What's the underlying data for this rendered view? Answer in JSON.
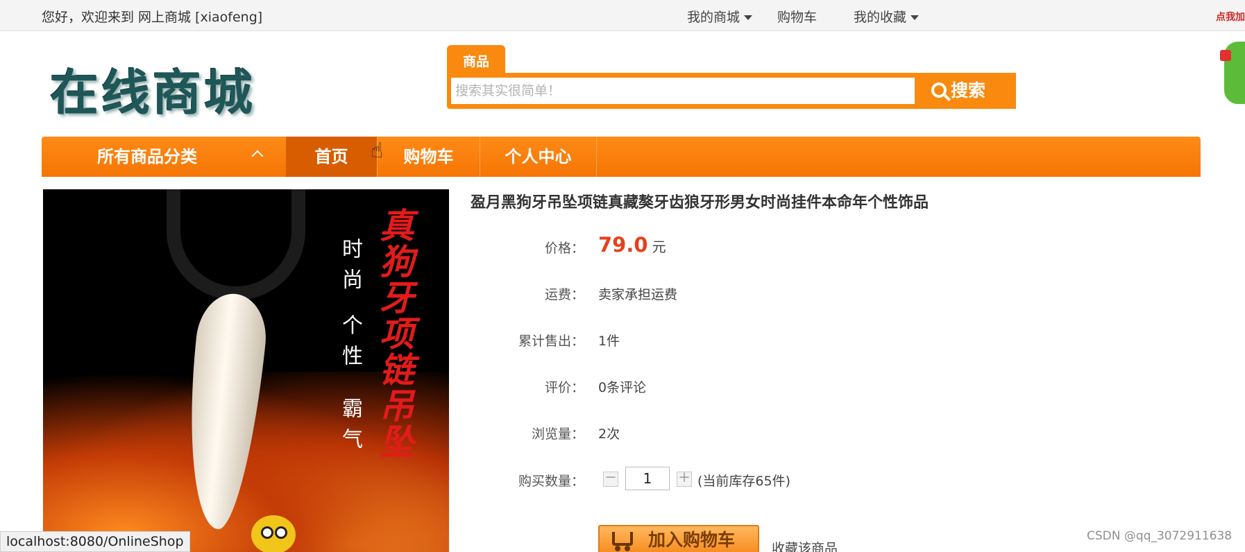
{
  "topbar": {
    "welcome": "您好，欢迎来到 网上商城 [xiaofeng]",
    "my_shop": "我的商城",
    "cart": "购物车",
    "favorites": "我的收藏",
    "ad_text": "点我加"
  },
  "logo": {
    "text": "在线商城"
  },
  "search": {
    "tab_label": "商品",
    "placeholder": "搜索其实很简单！",
    "button_label": "搜索"
  },
  "nav": {
    "category_label": "所有商品分类",
    "items": [
      {
        "label": "首页",
        "active": true
      },
      {
        "label": "购物车",
        "active": false
      },
      {
        "label": "个人中心",
        "active": false
      }
    ]
  },
  "product_image": {
    "text_white_1": "时尚",
    "text_white_2": "个性",
    "text_white_3": "霸气",
    "text_red": "真狗牙项链吊坠"
  },
  "product": {
    "title": "盈月黑狗牙吊坠项链真藏獒牙齿狼牙形男女时尚挂件本命年个性饰品",
    "price_label": "价格：",
    "price": "79.0",
    "price_unit": "元",
    "shipping_label": "运费：",
    "shipping": "卖家承担运费",
    "sold_label": "累计售出：",
    "sold": "1件",
    "review_label": "评价：",
    "reviews": "0条评论",
    "views_label": "浏览量：",
    "views": "2次",
    "qty_label": "购买数量：",
    "qty_value": "1",
    "qty_minus": "－",
    "qty_plus": "＋",
    "stock": "(当前库存65件)",
    "add_to_cart": "加入购物车",
    "favorite": "收藏该商品"
  },
  "status_url": "localhost:8080/OnlineShop",
  "watermark": "CSDN @qq_3072911638",
  "colors": {
    "accent": "#f98a0f",
    "nav_active": "#d85d00",
    "price": "#e8401a",
    "logo": "#1f5758"
  }
}
